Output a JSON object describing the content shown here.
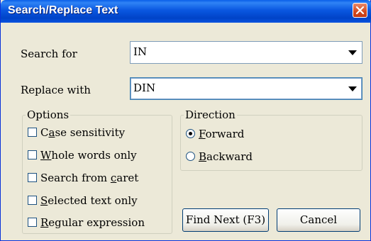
{
  "window": {
    "title": "Search/Replace Text"
  },
  "search": {
    "label": "Search for",
    "value": "IN"
  },
  "replace": {
    "label": "Replace with",
    "value": "DIN"
  },
  "options": {
    "title": "Options",
    "items": [
      {
        "pre": "C",
        "key": "a",
        "post": "se sensitivity",
        "checked": false
      },
      {
        "pre": "",
        "key": "W",
        "post": "hole words only",
        "checked": false
      },
      {
        "pre": "Search from ",
        "key": "c",
        "post": "aret",
        "checked": false
      },
      {
        "pre": "",
        "key": "S",
        "post": "elected text only",
        "checked": false
      },
      {
        "pre": "",
        "key": "R",
        "post": "egular expression",
        "checked": false
      }
    ]
  },
  "direction": {
    "title": "Direction",
    "forward": {
      "key": "F",
      "post": "orward",
      "selected": true
    },
    "backward": {
      "key": "B",
      "post": "ackward",
      "selected": false
    }
  },
  "buttons": {
    "find_next": "Find Next (F3)",
    "cancel": "Cancel"
  }
}
